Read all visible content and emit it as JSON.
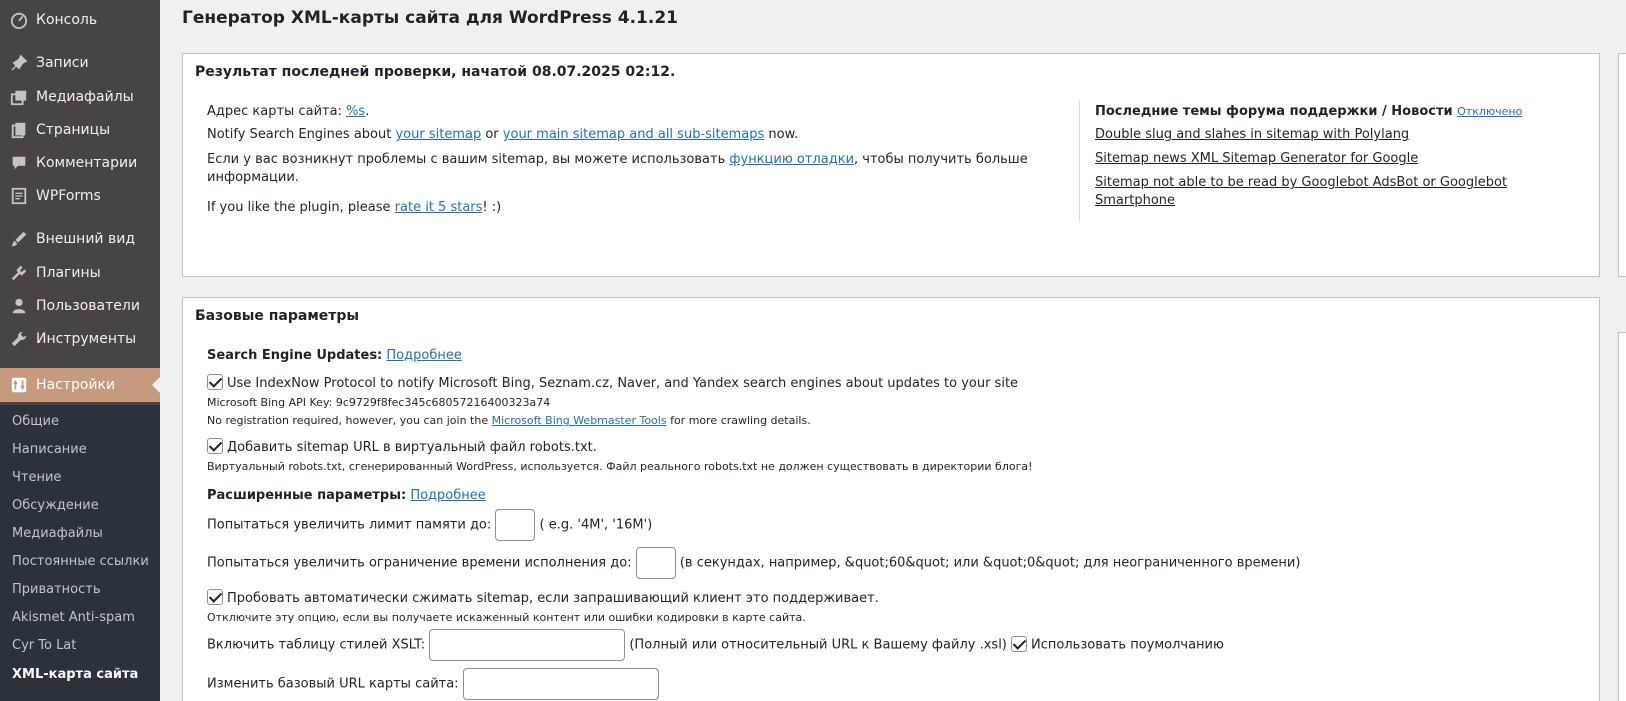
{
  "sidebar": {
    "menu": [
      {
        "label": "Консоль",
        "icon": "dashboard-icon"
      },
      {
        "label": "Записи",
        "icon": "pin-icon"
      },
      {
        "label": "Медиафайлы",
        "icon": "media-icon"
      },
      {
        "label": "Страницы",
        "icon": "pages-icon"
      },
      {
        "label": "Комментарии",
        "icon": "comment-icon"
      },
      {
        "label": "WPForms",
        "icon": "forms-icon"
      },
      {
        "label": "Внешний вид",
        "icon": "brush-icon"
      },
      {
        "label": "Плагины",
        "icon": "plugin-icon"
      },
      {
        "label": "Пользователи",
        "icon": "user-icon"
      },
      {
        "label": "Инструменты",
        "icon": "wrench-icon"
      },
      {
        "label": "Настройки",
        "icon": "settings-icon"
      }
    ],
    "submenu": [
      "Общие",
      "Написание",
      "Чтение",
      "Обсуждение",
      "Медиафайлы",
      "Постоянные ссылки",
      "Приватность",
      "Akismet Anti-spam",
      "Cyr To Lat",
      "XML-карта сайта"
    ]
  },
  "page_title": "Генератор XML-карты сайта для WordPress 4.1.21",
  "status_box": {
    "title": "Результат последней проверки, начатой 08.07.2025 02:12.",
    "sitemap_address_label": "Адрес карты сайта:",
    "sitemap_address_link": "%s",
    "notify_prefix": "Notify Search Engines about",
    "notify_link1": "your sitemap",
    "notify_or": "or",
    "notify_link2": "your main sitemap and all sub-sitemaps",
    "notify_suffix": "now.",
    "problem_text1": "Если у вас возникнут проблемы с вашим sitemap, вы можете использовать",
    "problem_link": "функцию отладки",
    "problem_text2": ", чтобы получить больше",
    "problem_text3": "информации.",
    "rate_prefix": "If you like the plugin, please",
    "rate_link": "rate it 5 stars",
    "rate_suffix": "! :)",
    "forum_title": "Последние темы форума поддержки / Новости",
    "forum_disabled": "Отключено",
    "forum_links": [
      "Double slug and slahes in sitemap with Polylang",
      "Sitemap news XML Sitemap Generator for Google",
      "Sitemap not able to be read by Googlebot AdsBot or Googlebot",
      "Smartphone"
    ]
  },
  "basic_box": {
    "title": "Базовые параметры",
    "se_updates_label": "Search Engine Updates:",
    "se_updates_link": "Подробнее",
    "indexnow_label": "Use IndexNow Protocol to notify Microsoft Bing, Seznam.cz, Naver, and Yandex search engines about updates to your site",
    "bing_key": "Microsoft Bing API Key: 9c9729f8fec345c68057216400323a74",
    "noreg_prefix": "No registration required, however, you can join the",
    "noreg_link": "Microsoft Bing Webmaster Tools",
    "noreg_suffix": "for more crawling details.",
    "robots_label": "Добавить sitemap URL в виртуальный файл robots.txt.",
    "robots_note": "Виртуальный robots.txt, сгенерированный WordPress, используется. Файл реального robots.txt не должен существовать в директории блога!",
    "advanced_label": "Расширенные параметры:",
    "advanced_link": "Подробнее",
    "memory_label": "Попытаться увеличить лимит памяти до:",
    "memory_hint": "( e.g. '4M', '16M')",
    "time_label": "Попытаться увеличить ограничение времени исполнения до:",
    "time_hint": "(в секундах, например, &quot;60&quot; или &quot;0&quot; для неограниченного времени)",
    "gzip_label": "Пробовать автоматически сжимать sitemap, если запрашивающий клиент это поддерживает.",
    "gzip_note": "Отключите эту опцию, если вы получаете искаженный контент или ошибки кодировки в карте сайта.",
    "xslt_label": "Включить таблицу стилей XSLT:",
    "xslt_hint": "(Полный или относительный URL к Вашему файлу .xsl)",
    "xslt_default": "Использовать поумолчанию",
    "base_url_label": "Изменить базовый URL карты сайта:"
  }
}
